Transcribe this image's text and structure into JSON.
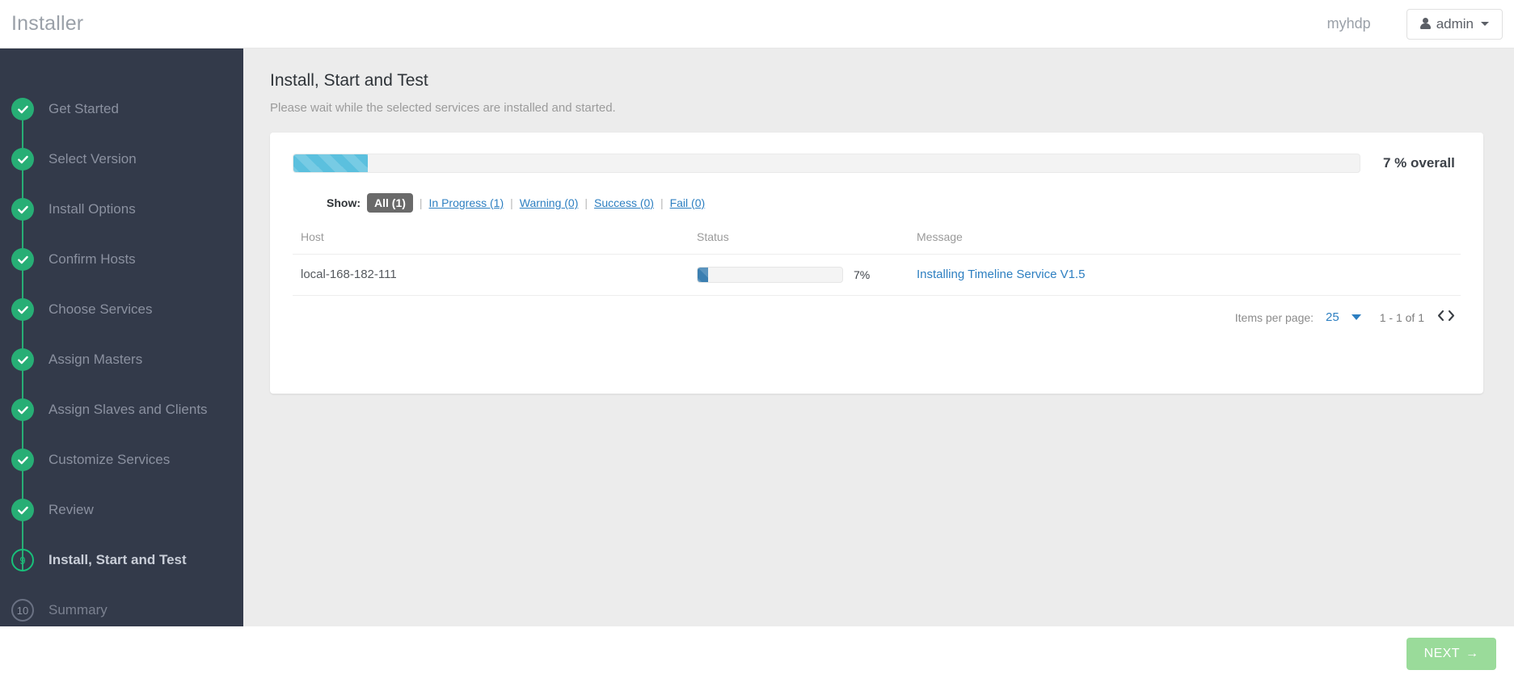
{
  "header": {
    "brand": "Installer",
    "cluster_name": "myhdp",
    "user_label": "admin",
    "user_icon": "user-icon",
    "caret_icon": "caret-down-icon"
  },
  "sidebar": {
    "steps": [
      {
        "label": "Get Started",
        "state": "done",
        "marker": "check"
      },
      {
        "label": "Select Version",
        "state": "done",
        "marker": "check"
      },
      {
        "label": "Install Options",
        "state": "done",
        "marker": "check"
      },
      {
        "label": "Confirm Hosts",
        "state": "done",
        "marker": "check"
      },
      {
        "label": "Choose Services",
        "state": "done",
        "marker": "check"
      },
      {
        "label": "Assign Masters",
        "state": "done",
        "marker": "check"
      },
      {
        "label": "Assign Slaves and Clients",
        "state": "done",
        "marker": "check"
      },
      {
        "label": "Customize Services",
        "state": "done",
        "marker": "check"
      },
      {
        "label": "Review",
        "state": "done",
        "marker": "check"
      },
      {
        "label": "Install, Start and Test",
        "state": "active",
        "marker": "9"
      },
      {
        "label": "Summary",
        "state": "todo",
        "marker": "10"
      }
    ]
  },
  "main": {
    "title": "Install, Start and Test",
    "subtitle": "Please wait while the selected services are installed and started.",
    "overall": {
      "percent": 7,
      "percent_label": "7 % overall"
    },
    "filters": {
      "show_label": "Show:",
      "separator": "|",
      "items": [
        {
          "label": "All (1)",
          "active": true
        },
        {
          "label": "In Progress (1)",
          "active": false
        },
        {
          "label": "Warning (0)",
          "active": false
        },
        {
          "label": "Success (0)",
          "active": false
        },
        {
          "label": "Fail (0)",
          "active": false
        }
      ]
    },
    "table": {
      "columns": [
        "Host",
        "Status",
        "Message"
      ],
      "rows": [
        {
          "host": "local-168-182-111",
          "status_percent": 7,
          "status_label": "7%",
          "message": "Installing Timeline Service V1.5"
        }
      ]
    },
    "paginator": {
      "items_per_page_label": "Items per page:",
      "items_per_page_value": "25",
      "range_label": "1 - 1 of 1",
      "prev_icon": "chevron-left-icon",
      "next_icon": "chevron-right-icon",
      "prev_glyph": "‹",
      "next_glyph": "›"
    }
  },
  "footer": {
    "next_label": "NEXT",
    "next_arrow": "→"
  },
  "colors": {
    "sidebar_bg": "#333a4a",
    "content_bg": "#ececec",
    "step_done": "#27ae75",
    "step_active": "#18c07a",
    "link": "#2d7fc1",
    "overall_bar": "#5bc0de",
    "row_bar": "#3c7fb1",
    "next_button": "#9adb9a"
  }
}
